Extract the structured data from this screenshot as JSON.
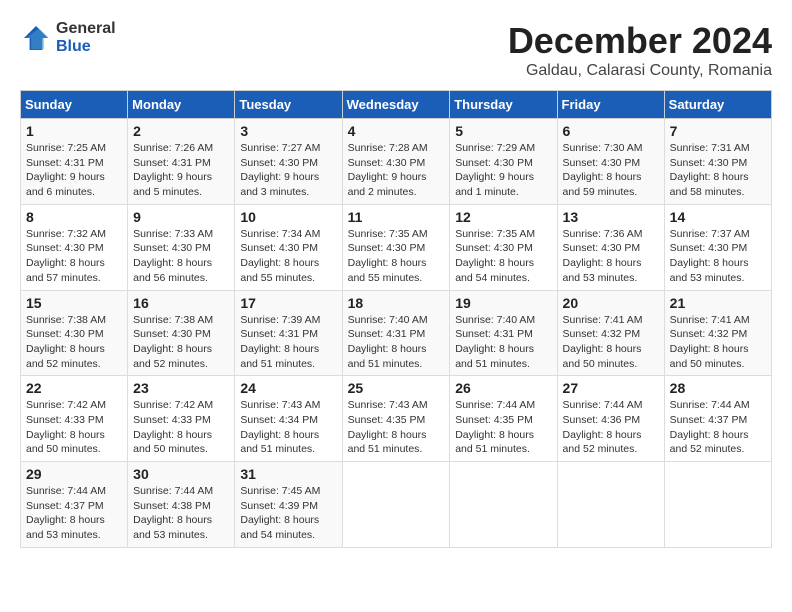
{
  "header": {
    "logo": {
      "general": "General",
      "blue": "Blue"
    },
    "title": "December 2024",
    "subtitle": "Galdau, Calarasi County, Romania"
  },
  "calendar": {
    "days_of_week": [
      "Sunday",
      "Monday",
      "Tuesday",
      "Wednesday",
      "Thursday",
      "Friday",
      "Saturday"
    ],
    "weeks": [
      [
        null,
        {
          "day": 2,
          "info": "Sunrise: 7:26 AM\nSunset: 4:31 PM\nDaylight: 9 hours\nand 5 minutes."
        },
        {
          "day": 3,
          "info": "Sunrise: 7:27 AM\nSunset: 4:30 PM\nDaylight: 9 hours\nand 3 minutes."
        },
        {
          "day": 4,
          "info": "Sunrise: 7:28 AM\nSunset: 4:30 PM\nDaylight: 9 hours\nand 2 minutes."
        },
        {
          "day": 5,
          "info": "Sunrise: 7:29 AM\nSunset: 4:30 PM\nDaylight: 9 hours\nand 1 minute."
        },
        {
          "day": 6,
          "info": "Sunrise: 7:30 AM\nSunset: 4:30 PM\nDaylight: 8 hours\nand 59 minutes."
        },
        {
          "day": 7,
          "info": "Sunrise: 7:31 AM\nSunset: 4:30 PM\nDaylight: 8 hours\nand 58 minutes."
        }
      ],
      [
        {
          "day": 1,
          "info": "Sunrise: 7:25 AM\nSunset: 4:31 PM\nDaylight: 9 hours\nand 6 minutes."
        },
        {
          "day": 8,
          "info": "Sunrise: 7:32 AM\nSunset: 4:30 PM\nDaylight: 8 hours\nand 57 minutes."
        },
        {
          "day": 9,
          "info": "Sunrise: 7:33 AM\nSunset: 4:30 PM\nDaylight: 8 hours\nand 56 minutes."
        },
        {
          "day": 10,
          "info": "Sunrise: 7:34 AM\nSunset: 4:30 PM\nDaylight: 8 hours\nand 55 minutes."
        },
        {
          "day": 11,
          "info": "Sunrise: 7:35 AM\nSunset: 4:30 PM\nDaylight: 8 hours\nand 55 minutes."
        },
        {
          "day": 12,
          "info": "Sunrise: 7:35 AM\nSunset: 4:30 PM\nDaylight: 8 hours\nand 54 minutes."
        },
        {
          "day": 13,
          "info": "Sunrise: 7:36 AM\nSunset: 4:30 PM\nDaylight: 8 hours\nand 53 minutes."
        },
        {
          "day": 14,
          "info": "Sunrise: 7:37 AM\nSunset: 4:30 PM\nDaylight: 8 hours\nand 53 minutes."
        }
      ],
      [
        {
          "day": 15,
          "info": "Sunrise: 7:38 AM\nSunset: 4:30 PM\nDaylight: 8 hours\nand 52 minutes."
        },
        {
          "day": 16,
          "info": "Sunrise: 7:38 AM\nSunset: 4:30 PM\nDaylight: 8 hours\nand 52 minutes."
        },
        {
          "day": 17,
          "info": "Sunrise: 7:39 AM\nSunset: 4:31 PM\nDaylight: 8 hours\nand 51 minutes."
        },
        {
          "day": 18,
          "info": "Sunrise: 7:40 AM\nSunset: 4:31 PM\nDaylight: 8 hours\nand 51 minutes."
        },
        {
          "day": 19,
          "info": "Sunrise: 7:40 AM\nSunset: 4:31 PM\nDaylight: 8 hours\nand 51 minutes."
        },
        {
          "day": 20,
          "info": "Sunrise: 7:41 AM\nSunset: 4:32 PM\nDaylight: 8 hours\nand 50 minutes."
        },
        {
          "day": 21,
          "info": "Sunrise: 7:41 AM\nSunset: 4:32 PM\nDaylight: 8 hours\nand 50 minutes."
        }
      ],
      [
        {
          "day": 22,
          "info": "Sunrise: 7:42 AM\nSunset: 4:33 PM\nDaylight: 8 hours\nand 50 minutes."
        },
        {
          "day": 23,
          "info": "Sunrise: 7:42 AM\nSunset: 4:33 PM\nDaylight: 8 hours\nand 50 minutes."
        },
        {
          "day": 24,
          "info": "Sunrise: 7:43 AM\nSunset: 4:34 PM\nDaylight: 8 hours\nand 51 minutes."
        },
        {
          "day": 25,
          "info": "Sunrise: 7:43 AM\nSunset: 4:35 PM\nDaylight: 8 hours\nand 51 minutes."
        },
        {
          "day": 26,
          "info": "Sunrise: 7:44 AM\nSunset: 4:35 PM\nDaylight: 8 hours\nand 51 minutes."
        },
        {
          "day": 27,
          "info": "Sunrise: 7:44 AM\nSunset: 4:36 PM\nDaylight: 8 hours\nand 52 minutes."
        },
        {
          "day": 28,
          "info": "Sunrise: 7:44 AM\nSunset: 4:37 PM\nDaylight: 8 hours\nand 52 minutes."
        }
      ],
      [
        {
          "day": 29,
          "info": "Sunrise: 7:44 AM\nSunset: 4:37 PM\nDaylight: 8 hours\nand 53 minutes."
        },
        {
          "day": 30,
          "info": "Sunrise: 7:44 AM\nSunset: 4:38 PM\nDaylight: 8 hours\nand 53 minutes."
        },
        {
          "day": 31,
          "info": "Sunrise: 7:45 AM\nSunset: 4:39 PM\nDaylight: 8 hours\nand 54 minutes."
        },
        null,
        null,
        null,
        null
      ]
    ]
  }
}
